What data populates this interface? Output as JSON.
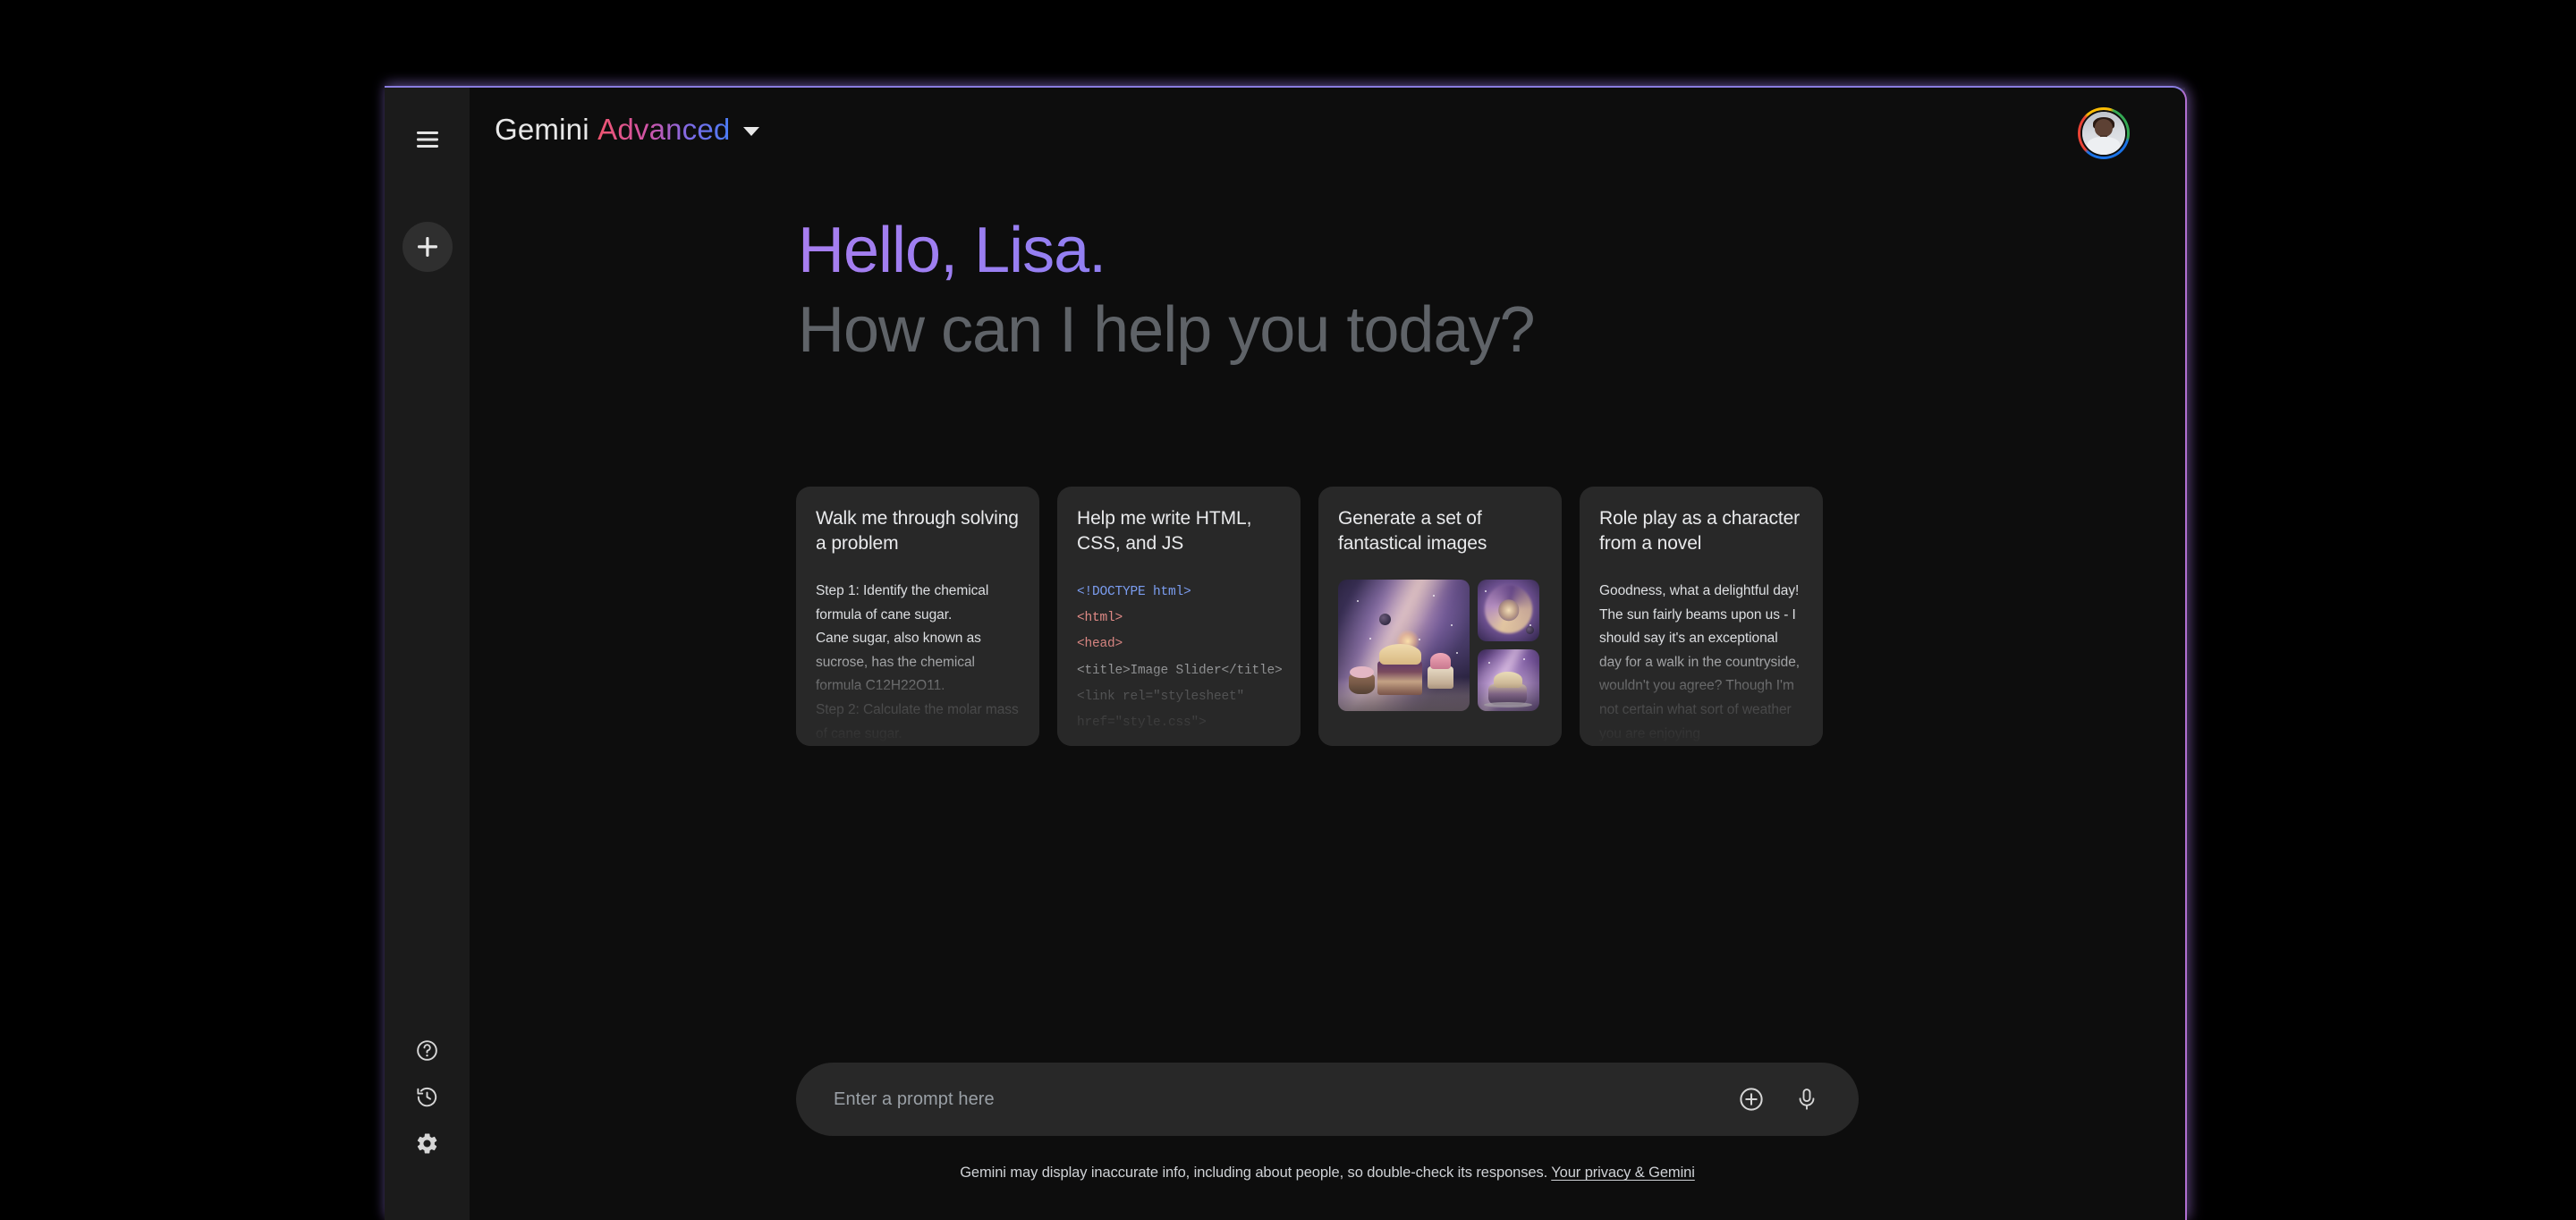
{
  "app": {
    "brand_primary": "Gemini",
    "brand_secondary": "Advanced",
    "accent_gradient_start": "#f0556f",
    "accent_gradient_end": "#4a7df5",
    "window_border_color": "#b06fd0"
  },
  "sidebar": {
    "menu_icon": "hamburger-menu-icon",
    "new_chat_icon": "plus-icon",
    "bottom_items": [
      {
        "icon": "help-circle-icon",
        "name": "help"
      },
      {
        "icon": "history-clock-icon",
        "name": "activity"
      },
      {
        "icon": "gear-icon",
        "name": "settings"
      }
    ]
  },
  "header": {
    "model_selector_caret": "chevron-down-icon",
    "avatar_name": "user-avatar"
  },
  "greeting": {
    "hello": "Hello, Lisa.",
    "question": "How can I help you today?",
    "hello_color_start": "#a87ef0",
    "hello_color_end": "#5b8df8",
    "question_color": "#5f6368"
  },
  "cards": [
    {
      "id": "walk-through-problem",
      "title": "Walk me through solving a problem",
      "body": "Step 1: Identify the chemical formula of cane sugar.\nCane sugar, also known as sucrose, has the chemical formula C12H22O11.\nStep 2: Calculate the molar mass of cane sugar."
    },
    {
      "id": "write-html-css-js",
      "title": "Help me write HTML, CSS, and JS",
      "code_lines": [
        {
          "text": "<!DOCTYPE html>",
          "token": "doctype"
        },
        {
          "text": "<html>",
          "token": "tag"
        },
        {
          "text": "<head>",
          "token": "tag"
        },
        {
          "text": "<title>Image Slider</title>",
          "token": "plain"
        },
        {
          "text": "<link rel=\"stylesheet\"",
          "token": "attr"
        },
        {
          "text": "href=\"style.css\">",
          "token": "attr"
        }
      ]
    },
    {
      "id": "generate-fantastical-images",
      "title": "Generate a set of fantastical images",
      "images": [
        {
          "name": "cosmic-cake-large",
          "alt": "galaxy with layered cakes"
        },
        {
          "name": "golden-spiral-galaxy",
          "alt": "golden spiral nebula"
        },
        {
          "name": "cosmic-dessert-small",
          "alt": "dessert in nebula"
        }
      ]
    },
    {
      "id": "role-play-character",
      "title": "Role play as a character from a novel",
      "body": "Goodness, what a delightful day! The sun fairly beams upon us - I should say it's an exceptional day for a walk in the countryside, wouldn't you agree? Though I'm not certain what sort of weather you are enjoying"
    }
  ],
  "prompt": {
    "placeholder": "Enter a prompt here",
    "value": "",
    "add_icon": "plus-circle-icon",
    "mic_icon": "microphone-icon"
  },
  "footer": {
    "disclaimer": "Gemini may display inaccurate info, including about people, so double-check its responses.",
    "link_text": "Your privacy & Gemini"
  }
}
